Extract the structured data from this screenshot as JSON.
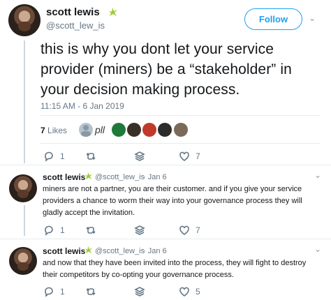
{
  "main_tweet": {
    "name": "scott lewis",
    "handle": "@scott_lew_is",
    "follow_label": "Follow",
    "text": "this is why you dont let your service provider (miners) be a “stakeholder” in your decision making process.",
    "timestamp": "11:15 AM - 6 Jan 2019",
    "likes_count": "7",
    "likes_label": "Likes",
    "reply_count": "1",
    "retweet_count": "",
    "like_count": "7"
  },
  "replies": [
    {
      "name": "scott lewis",
      "handle": "@scott_lew_is",
      "date": "· Jan 6",
      "text": "miners are not a partner, you are their customer. and if you give your service providers a chance to worm their way into your governance process they will gladly accept the invitation.",
      "reply_count": "1",
      "like_count": "7"
    },
    {
      "name": "scott lewis",
      "handle": "@scott_lew_is",
      "date": "· Jan 6",
      "text": "and now that they have been invited into the process, they will fight to destroy their competitors by co-opting your governance process.",
      "reply_count": "1",
      "like_count": "5"
    }
  ],
  "liker_avatar_glyph": "pll",
  "colors": {
    "accent": "#1da1f2",
    "muted": "#657786",
    "divider": "#e6ecf0",
    "verified": "#9acd32"
  }
}
